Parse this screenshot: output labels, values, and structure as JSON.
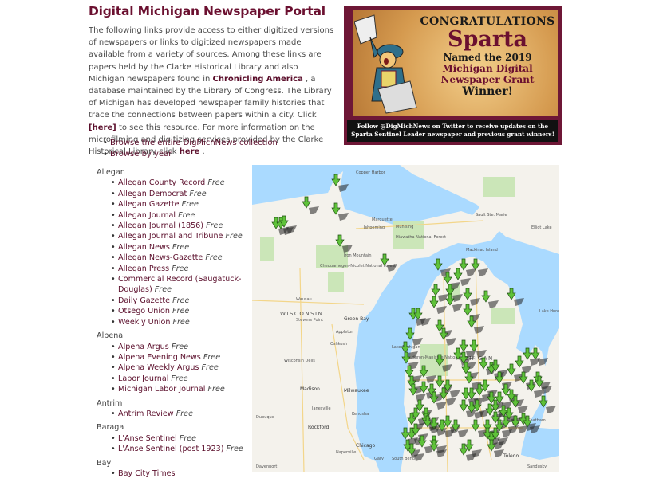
{
  "page": {
    "title": "Digital Michigan Newspaper Portal",
    "intro": {
      "p1": "The following links provide access to either digitized versions of newspapers or links to digitized newspapers made available from a variety of sources.  Among these links are papers held by the Clarke Historical Library and also Michigan newspapers found in",
      "link_chronicling": "Chronicling America",
      "p2": ", a database maintained by the Library of Congress. The Library of Michigan has developed newspaper family histories that trace the connections between papers within a city.  Click",
      "link_here1": "[here]",
      "p3": "to see this resource. For more information on the microfilming and digitizing services provided by the Clarke Historical Library click",
      "link_here2": "here",
      "p4": "."
    },
    "browse": [
      "Browse the entire DigMichNews collection",
      "Browse by year"
    ]
  },
  "banner": {
    "line1": "CONGRATULATIONS",
    "line2": "Sparta",
    "line3": "Named the 2019",
    "line4": "Michigan Digital",
    "line5": "Newspaper Grant",
    "line6": "Winner!",
    "footer1": "Follow @DigMichNews on Twitter to receive updates on the",
    "footer2": "Sparta Sentinel Leader newspaper and previous grant winners!",
    "colors": {
      "frame": "#6e1736",
      "accent": "#6b1030"
    }
  },
  "free_label": "Free",
  "counties": [
    {
      "name": "Allegan",
      "papers": [
        "Allegan County Record",
        "Allegan Democrat",
        "Allegan Gazette",
        "Allegan Journal",
        "Allegan Journal (1856)",
        "Allegan Journal and Tribune",
        "Allegan News",
        "Allegan News-Gazette",
        "Allegan Press",
        "Commercial Record (Saugatuck-Douglas)",
        "Daily Gazette",
        "Otsego Union",
        "Weekly Union"
      ]
    },
    {
      "name": "Alpena",
      "papers": [
        "Alpena Argus",
        "Alpena Evening News",
        "Alpena Weekly Argus",
        "Labor Journal",
        "Michigan Labor Journal"
      ]
    },
    {
      "name": "Antrim",
      "papers": [
        "Antrim Review"
      ]
    },
    {
      "name": "Baraga",
      "papers": [
        "L'Anse Sentinel",
        "L'Anse Sentinel (post 1923)"
      ]
    },
    {
      "name": "Bay",
      "papers": [
        "Bay City Times"
      ]
    }
  ],
  "map": {
    "labels": [
      "Copper Harbor",
      "Marquette",
      "Ishpeming",
      "Munising",
      "Hiawatha National Forest",
      "Sault Ste. Marie",
      "Elliot Lake",
      "Mackinac Island",
      "Iron Mountain",
      "Chequamegon-Nicolet National Forest",
      "Wausau",
      "WISCONSIN",
      "Stevens Point",
      "Green Bay",
      "Appleton",
      "Oshkosh",
      "Wisconsin Dells",
      "Madison",
      "Milwaukee",
      "Janesville",
      "Kenosha",
      "Dubuque",
      "Rockford",
      "Chicago",
      "Naperville",
      "Gary",
      "South Bend",
      "Toledo",
      "Lake Michigan",
      "Lake Huron",
      "MICHIGAN",
      "Huron-Manistee National Forest",
      "Chatham",
      "Sandusky",
      "Davenport"
    ],
    "colors": {
      "water": "#aadaff",
      "land": "#f4f2ec",
      "forest": "#cbe6b8",
      "marker": "#5fc23a"
    }
  }
}
